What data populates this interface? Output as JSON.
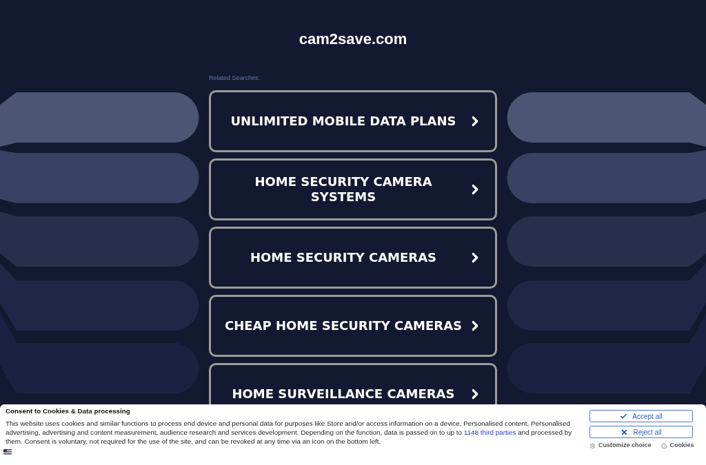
{
  "site_title": "cam2save.com",
  "related_searches": {
    "label": "Related Searches:",
    "items": [
      {
        "text": "UNLIMITED MOBILE DATA PLANS"
      },
      {
        "text": "HOME SECURITY CAMERA SYSTEMS"
      },
      {
        "text": "HOME SECURITY CAMERAS"
      },
      {
        "text": "CHEAP HOME SECURITY CAMERAS"
      },
      {
        "text": "HOME SURVEILLANCE CAMERAS"
      }
    ]
  },
  "cookie_banner": {
    "title": "Consent to Cookies & Data processing",
    "text_before_link": "This website uses cookies and similar functions to process end device and personal data for purposes like Store and/or access information on a device, Personalised content, Personalised advertising, advertising and content measurement, audience research and services development. Depending on the function, data is passed on to up to",
    "link": "1148 third parties",
    "text_after_link": "and processed by them. Consent is voluntary, not required for the use of the site, and can be revoked at any time via an icon on the bottom left.",
    "buttons": [
      {
        "label": "Accept all",
        "kind": "accept"
      },
      {
        "label": "Reject all",
        "kind": "reject"
      }
    ],
    "links": [
      {
        "label": "Customize choice",
        "kind": "customize"
      },
      {
        "label": "Cookies",
        "kind": "cookies"
      }
    ]
  }
}
